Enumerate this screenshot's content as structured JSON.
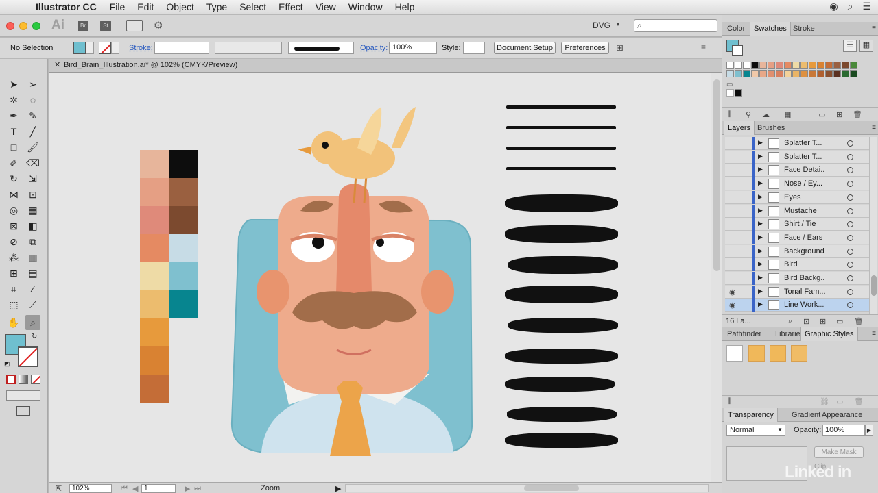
{
  "menubar": {
    "app_name": "Illustrator CC",
    "items": [
      "File",
      "Edit",
      "Object",
      "Type",
      "Select",
      "Effect",
      "View",
      "Window",
      "Help"
    ]
  },
  "appbar": {
    "workspace": "DVG",
    "badges": [
      "Br",
      "St"
    ]
  },
  "control_bar": {
    "selection": "No Selection",
    "stroke_label": "Stroke:",
    "opacity_label": "Opacity:",
    "opacity_value": "100%",
    "style_label": "Style:",
    "document_setup": "Document Setup",
    "preferences": "Preferences"
  },
  "document": {
    "tab_title": "Bird_Brain_Illustration.ai* @ 102% (CMYK/Preview)"
  },
  "status_bar": {
    "zoom": "102%",
    "artboard": "1",
    "tool_name": "Zoom"
  },
  "palette_colors": {
    "left": [
      "#e7b59b",
      "#e59f84",
      "#df8a7a",
      "#e58a62",
      "#eedba6",
      "#ecbc6e",
      "#e79a3c",
      "#d98232",
      "#c46d37"
    ],
    "right": [
      "#0d0d0d",
      "#9a6040",
      "#7c4a2f",
      "#c7dce6",
      "#7fc0cf",
      "#07858f"
    ]
  },
  "color_panel": {
    "tabs": [
      "Color",
      "Swatches",
      "Stroke"
    ]
  },
  "layers_panel": {
    "tabs": [
      "Layers",
      "Brushes"
    ],
    "layers": [
      "Splatter T...",
      "Splatter T...",
      "Face Detai...",
      "Nose / Ey...",
      "Eyes",
      "Mustache",
      "Shirt / Tie",
      "Face / Ears",
      "Background",
      "Bird",
      "Bird Backg...",
      "Tonal Fam...",
      "Line Work..."
    ],
    "count": "16 La..."
  },
  "styles_panel": {
    "tabs": [
      "Pathfinder",
      "Libraries",
      "Graphic Styles"
    ]
  },
  "transparency_panel": {
    "tabs": [
      "Transparency",
      "Gradient",
      "Appearance"
    ],
    "blend_mode": "Normal",
    "opacity_label": "Opacity:",
    "opacity_value": "100%",
    "make_mask": "Make Mask",
    "clip": "Clip"
  },
  "watermark": "Linked in"
}
